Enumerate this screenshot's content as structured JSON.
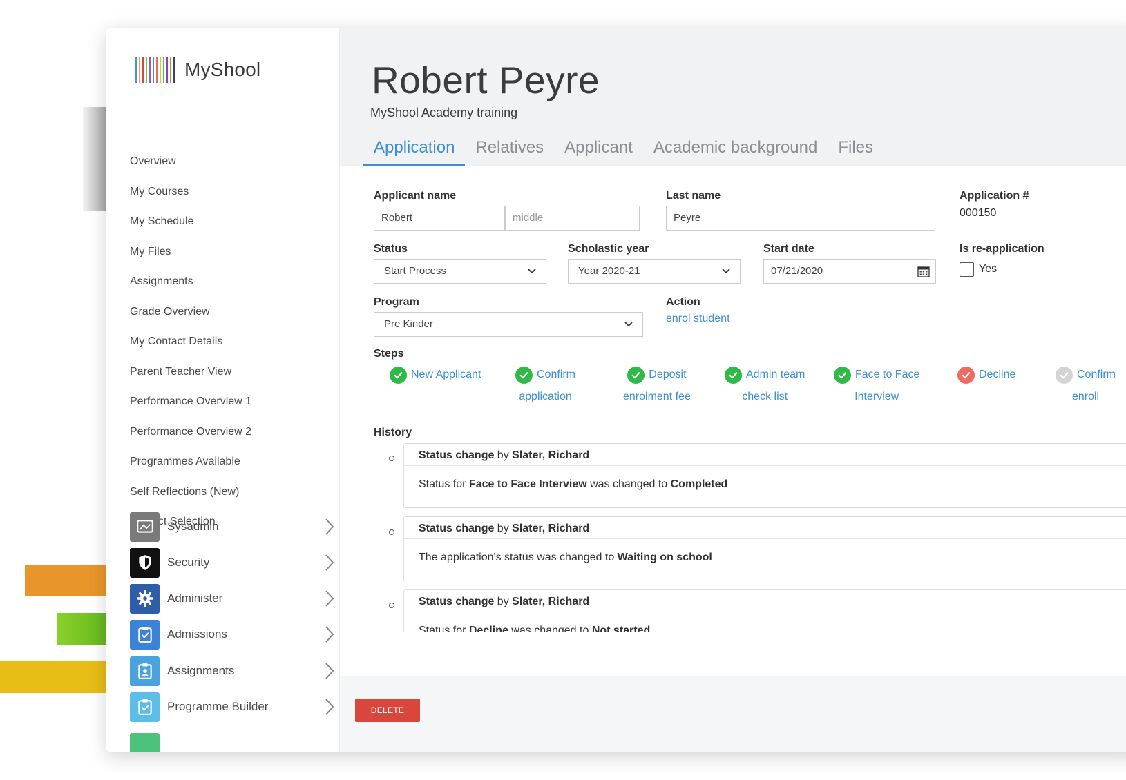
{
  "brand": {
    "name": "MyShool",
    "logo_colors": [
      "#4a90d9",
      "#e9a23b",
      "#d9463e",
      "#7bc043",
      "#9b59b6",
      "#3d8fd1",
      "#e86b5f",
      "#f1c40f",
      "#2ecc71",
      "#8e44ad",
      "#e67e22",
      "#34495e"
    ]
  },
  "sidebar": {
    "nav": [
      "Overview",
      "My Courses",
      "My Schedule",
      "My Files",
      "Assignments",
      "Grade Overview",
      "My Contact Details",
      "Parent Teacher View",
      "Performance Overview 1",
      "Performance Overview 2",
      "Programmes Available",
      "Self Reflections (New)",
      "Subject Selection"
    ],
    "modules": [
      {
        "label": "Sysadmin",
        "icon": "monitor-icon",
        "color": "#7a7a7a"
      },
      {
        "label": "Security",
        "icon": "shield-icon",
        "color": "#111111"
      },
      {
        "label": "Administer",
        "icon": "gear-icon",
        "color": "#2f5ea8"
      },
      {
        "label": "Admissions",
        "icon": "clipboard-check-icon",
        "color": "#3c82d6"
      },
      {
        "label": "Assignments",
        "icon": "id-badge-icon",
        "color": "#4aa3dd"
      },
      {
        "label": "Programme Builder",
        "icon": "clipboard-check-icon",
        "color": "#5bbde8"
      }
    ]
  },
  "header": {
    "name": "Robert Peyre",
    "subtitle": "MyShool Academy training",
    "tabs": [
      "Application",
      "Relatives",
      "Applicant",
      "Academic background",
      "Files"
    ]
  },
  "form": {
    "applicant_name_label": "Applicant name",
    "first_name": "Robert",
    "middle_placeholder": "middle",
    "last_name_label": "Last name",
    "last_name": "Peyre",
    "application_no_label": "Application #",
    "application_no": "000150",
    "status_label": "Status",
    "status": "Start Process",
    "year_label": "Scholastic year",
    "year": "Year 2020-21",
    "start_date_label": "Start date",
    "start_date": "07/21/2020",
    "reapp_label": "Is re-application",
    "reapp_option": "Yes",
    "program_label": "Program",
    "program": "Pre Kinder",
    "action_label": "Action",
    "action_link": "enrol student",
    "steps_label": "Steps",
    "history_label": "History"
  },
  "steps": [
    {
      "line1": "New Applicant",
      "line2": "",
      "state": "done"
    },
    {
      "line1": "Confirm",
      "line2": "application",
      "state": "done"
    },
    {
      "line1": "Deposit",
      "line2": "enrolment fee",
      "state": "done"
    },
    {
      "line1": "Admin team",
      "line2": "check list",
      "state": "done"
    },
    {
      "line1": "Face to Face",
      "line2": "Interview",
      "state": "done"
    },
    {
      "line1": "Decline",
      "line2": "",
      "state": "declined"
    },
    {
      "line1": "Confirm",
      "line2": "enroll",
      "state": "pending"
    }
  ],
  "history": [
    {
      "head_a": "Status change",
      "head_b": " by ",
      "head_c": "Slater, Richard",
      "b1": "Status for ",
      "b2": "Face to Face Interview",
      "b3": " was changed to ",
      "b4": "Completed"
    },
    {
      "head_a": "Status change",
      "head_b": " by ",
      "head_c": "Slater, Richard",
      "b1": "The application's status was changed to ",
      "b2": "Waiting on school",
      "b3": "",
      "b4": ""
    },
    {
      "head_a": "Status change",
      "head_b": " by ",
      "head_c": "Slater, Richard",
      "b1": "Status for ",
      "b2": "Decline",
      "b3": " was changed to ",
      "b4": "Not started"
    }
  ],
  "footer": {
    "delete_label": "DELETE"
  },
  "colors": {
    "accent": "#3d8fd1",
    "done": "#2fba47",
    "declined": "#ee6b62",
    "pending": "#d4d4d4",
    "danger": "#d9463e"
  }
}
